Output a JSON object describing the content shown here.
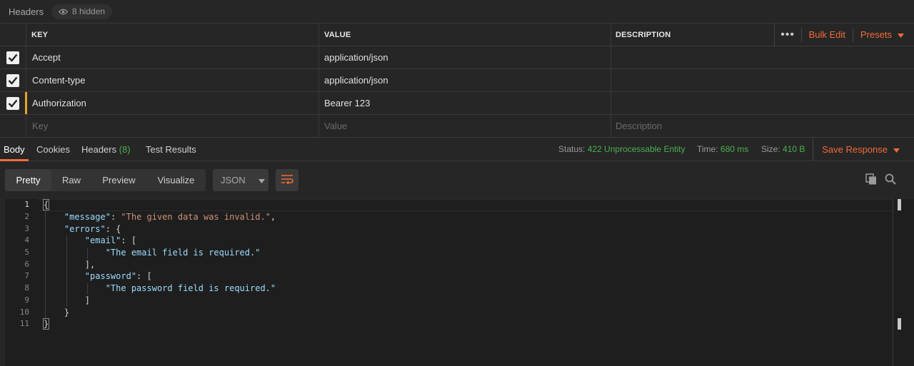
{
  "headers_section": {
    "title": "Headers",
    "hidden_label": "8 hidden"
  },
  "table": {
    "columns": {
      "key": "KEY",
      "value": "VALUE",
      "description": "DESCRIPTION"
    },
    "actions": {
      "more": "•••",
      "bulk_edit": "Bulk Edit",
      "presets": "Presets"
    },
    "rows": [
      {
        "key": "Accept",
        "value": "application/json",
        "description": "",
        "checked": true
      },
      {
        "key": "Content-type",
        "value": "application/json",
        "description": "",
        "checked": true
      },
      {
        "key": "Authorization",
        "value": "Bearer 123",
        "description": "",
        "checked": true
      }
    ],
    "placeholder": {
      "key": "Key",
      "value": "Value",
      "description": "Description"
    }
  },
  "response": {
    "tabs": {
      "body": "Body",
      "cookies": "Cookies",
      "headers": "Headers",
      "headers_count": "(8)",
      "test_results": "Test Results"
    },
    "status_label": "Status:",
    "status_value": "422 Unprocessable Entity",
    "time_label": "Time:",
    "time_value": "680 ms",
    "size_label": "Size:",
    "size_value": "410 B",
    "save_label": "Save Response"
  },
  "view": {
    "modes": [
      "Pretty",
      "Raw",
      "Preview",
      "Visualize"
    ],
    "format": "JSON"
  },
  "editor": {
    "line_numbers": [
      "1",
      "2",
      "3",
      "4",
      "5",
      "6",
      "7",
      "8",
      "9",
      "10",
      "11"
    ],
    "message_key": "\"message\"",
    "message_value": "\"The given data was invalid.\"",
    "errors_key": "\"errors\"",
    "email_key": "\"email\"",
    "email_value": "\"The email field is required.\"",
    "password_key": "\"password\"",
    "password_value": "\"The password field is required.\""
  },
  "colors": {
    "accent": "#f26b3a",
    "success": "#4caf50",
    "active_row": "#e8a32c"
  }
}
